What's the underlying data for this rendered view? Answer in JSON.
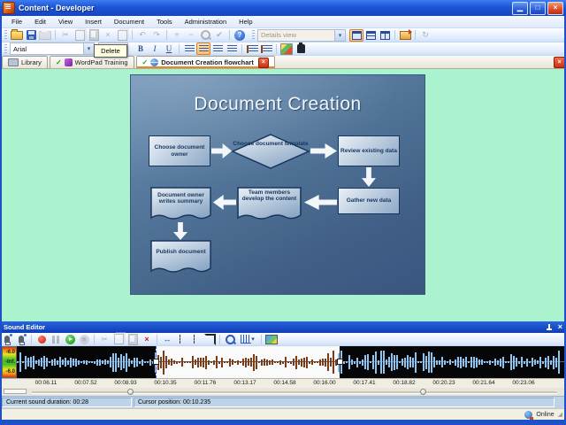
{
  "window": {
    "title": "Content - Developer"
  },
  "icons": {
    "minimize": "▁",
    "maximize": "□",
    "close": "×",
    "check": "✓",
    "dropdown": "▾",
    "help": "?",
    "cut": "✂",
    "delete": "×",
    "undo": "↶",
    "redo": "↷",
    "plus": "+",
    "minus": "−",
    "spellcheck": "✔",
    "refresh": "↻",
    "marker": "↔",
    "resize_grip": "◢"
  },
  "menu": {
    "items": [
      "File",
      "Edit",
      "View",
      "Insert",
      "Document",
      "Tools",
      "Administration",
      "Help"
    ]
  },
  "toolbar_main": {
    "details_view_value": "Details view"
  },
  "toolbar_format": {
    "font_value": "Arial",
    "size_value": "1",
    "tooltip": "Delete",
    "bold": "B",
    "italic": "I",
    "underline": "U"
  },
  "tabs": {
    "library": "Library",
    "wordpad": "WordPad Training",
    "flowchart": "Document Creation flowchart"
  },
  "slide": {
    "title": "Document Creation",
    "nodes": {
      "choose_owner": {
        "label": "Choose document owner"
      },
      "choose_template": {
        "label": "Choose document template"
      },
      "review_data": {
        "label": "Review existing data"
      },
      "owner_summary": {
        "label": "Document owner writes summary"
      },
      "team_develop": {
        "label": "Team members develop the content"
      },
      "gather_data": {
        "label": "Gather new data"
      },
      "publish": {
        "label": "Publish document"
      }
    }
  },
  "sound_editor": {
    "title": "Sound Editor",
    "meter": {
      "top": "-6.0",
      "mid": "-Inf.",
      "bottom": "-6.0"
    },
    "timeline_labels": [
      "00:06.11",
      "00:07.52",
      "00:08.93",
      "00:10.35",
      "00:11.76",
      "00:13.17",
      "00:14.58",
      "00:16.00",
      "00:17.41",
      "00:18.82",
      "00:20.23",
      "00:21.64",
      "00:23.06"
    ],
    "selection": {
      "start_frac": 0.254,
      "end_frac": 0.59
    }
  },
  "status_bar": {
    "duration": "Current sound duration: 00:28",
    "cursor": "Cursor position: 00:10.235"
  },
  "app_bar": {
    "online": "Online"
  }
}
